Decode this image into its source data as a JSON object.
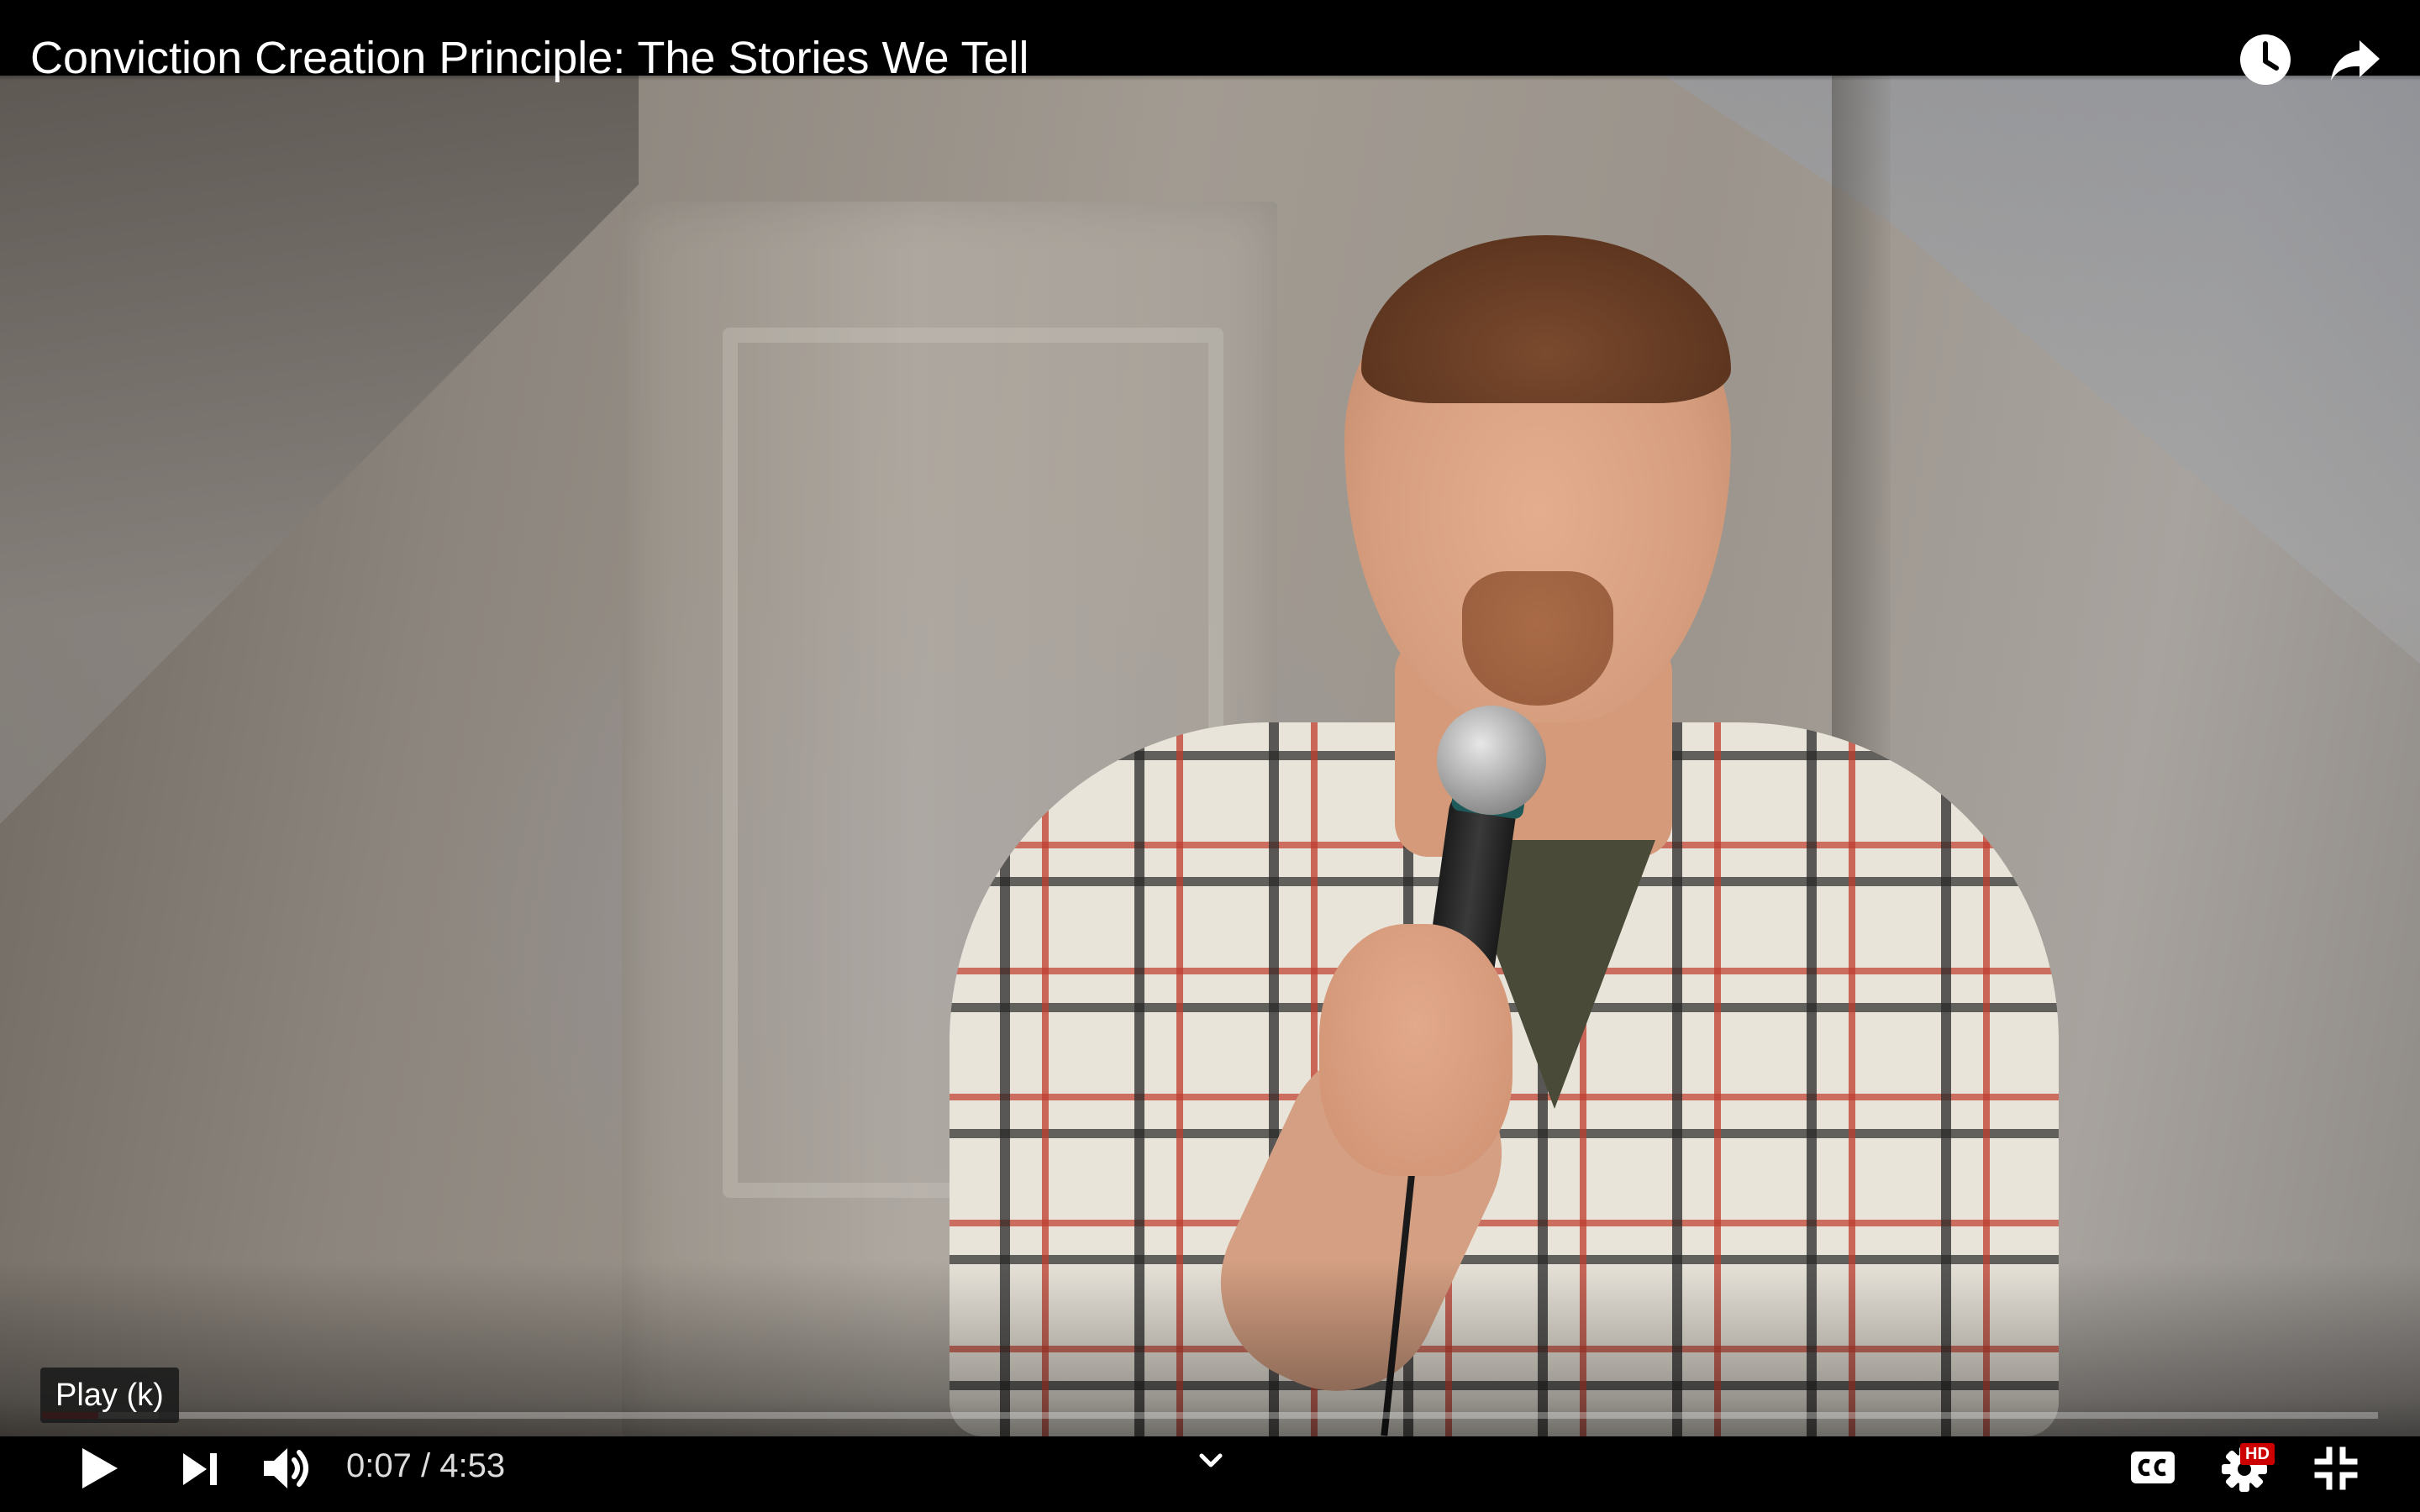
{
  "video": {
    "title": "Conviction Creation Principle: The Stories We Tell",
    "progress_played_fraction": 0.024,
    "progress_loaded_fraction": 0.05
  },
  "top_bar": {
    "icons": [
      "watch-later-icon",
      "share-icon"
    ]
  },
  "controls": {
    "tooltip": "Play (k)",
    "current_time": "0:07",
    "separator": "/",
    "duration": "4:53",
    "time_display": "0:07 / 4:53",
    "hd_badge": "HD",
    "icons": [
      "play-icon",
      "next-icon",
      "volume-icon",
      "chevron-down-icon",
      "captions-icon",
      "settings-icon",
      "exit-fullscreen-icon"
    ]
  },
  "colors": {
    "background": "#000000",
    "text": "#ffffff",
    "progress_played": "#ff0000",
    "hd_badge": "#cc0000"
  }
}
